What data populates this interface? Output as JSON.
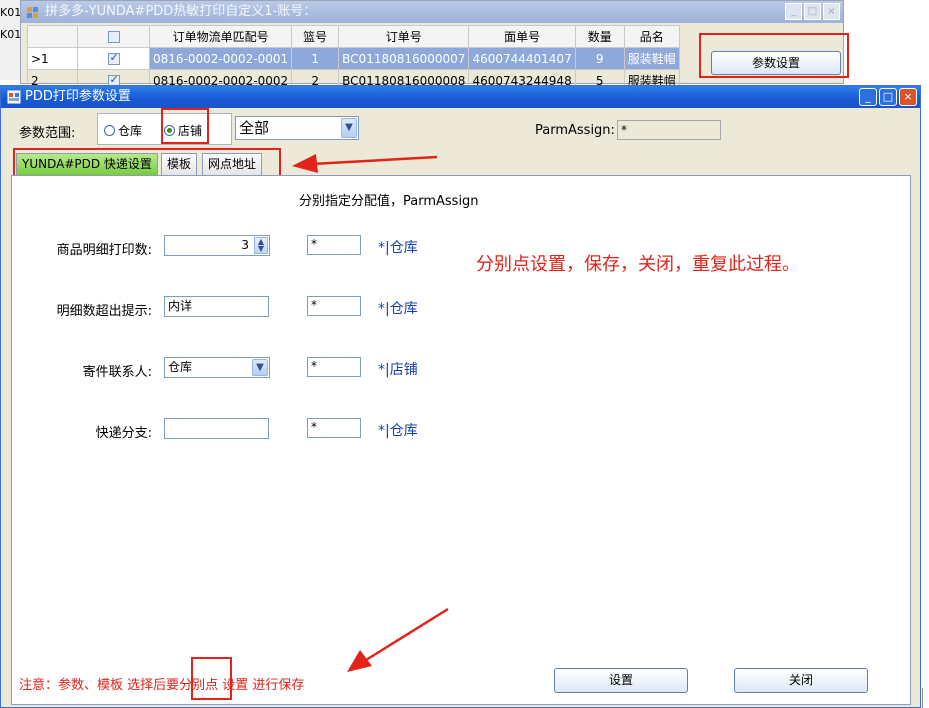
{
  "background_window": {
    "left_strip_lines": [
      "K01",
      "K01"
    ],
    "title": "拼多多-YUNDA#PDD热敏打印自定义1-账号：",
    "title_buttons": [
      "_",
      "□",
      "×"
    ],
    "table": {
      "headers": [
        "",
        "",
        "订单物流单匹配号",
        "篮号",
        "订单号",
        "面单号",
        "数量",
        "品名"
      ],
      "rows": [
        {
          "row_header": ">1",
          "match_no": "0816-0002-0002-0001",
          "basket": "1",
          "order_no": "BC01180816000007",
          "waybill": "4600744401407",
          "qty": "9",
          "product": "服装鞋帽",
          "checked": true
        },
        {
          "row_header": "2",
          "match_no": "0816-0002-0002-0002",
          "basket": "2",
          "order_no": "BC01180816000008",
          "waybill": "4600743244948",
          "qty": "5",
          "product": "服装鞋帽",
          "checked": true
        }
      ]
    },
    "param_button_label": "参数设置"
  },
  "dialog": {
    "title": "PDD打印参数设置",
    "title_buttons": [
      "_",
      "□",
      "×"
    ],
    "scope_label": "参数范围:",
    "radio_warehouse": "仓库",
    "radio_store": "店铺",
    "scope_selected": "店铺",
    "combo_value": "全部",
    "parm_assign_label": "ParmAssign:",
    "parm_assign_value": "*",
    "tabs": [
      {
        "label": "YUNDA#PDD 快递设置",
        "active": true
      },
      {
        "label": "模板",
        "active": false
      },
      {
        "label": "网点地址",
        "active": false
      }
    ],
    "panel_note": "分别指定分配值，ParmAssign",
    "fields": [
      {
        "label": "商品明细打印数:",
        "value": "3",
        "kind": "spinner",
        "assign": "*",
        "assign_text": "*|仓库"
      },
      {
        "label": "明细数超出提示:",
        "value": "内详",
        "kind": "text",
        "assign": "*",
        "assign_text": "*|仓库"
      },
      {
        "label": "寄件联系人:",
        "value": "仓库",
        "kind": "combo",
        "assign": "*",
        "assign_text": "*|店铺"
      },
      {
        "label": "快递分支:",
        "value": "",
        "kind": "text",
        "assign": "*",
        "assign_text": "*|仓库"
      }
    ],
    "instruction": "分别点设置，保存，关闭，重复此过程。",
    "footer_note": "注意：参数、模板 选择后要分别点 设置 进行保存",
    "btn_set": "设置",
    "btn_close": "关闭"
  },
  "colors": {
    "annotation_red": "#e2231a",
    "titlebar_blue": "#1858d4",
    "tab_green": "#78cc3d",
    "assign_blue": "#1a3fb0"
  }
}
